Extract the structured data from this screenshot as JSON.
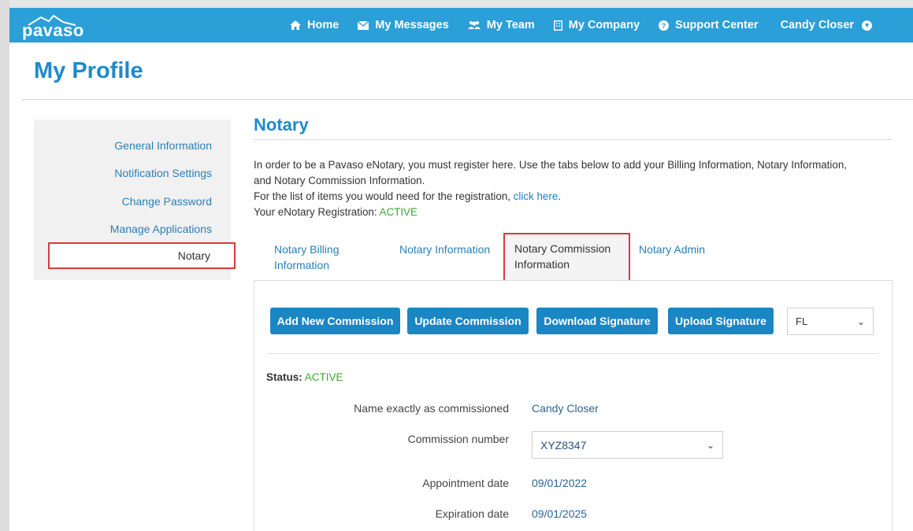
{
  "brand": {
    "logo_text": "pavaso"
  },
  "nav": {
    "items": [
      {
        "label": "Home",
        "icon": "home-icon"
      },
      {
        "label": "My Messages",
        "icon": "envelope-icon"
      },
      {
        "label": "My Team",
        "icon": "team-icon"
      },
      {
        "label": "My Company",
        "icon": "building-icon"
      },
      {
        "label": "Support Center",
        "icon": "question-circle-icon"
      }
    ],
    "user": "Candy Closer"
  },
  "page": {
    "title": "My Profile"
  },
  "sidebar": {
    "items": [
      {
        "label": "General Information"
      },
      {
        "label": "Notification Settings"
      },
      {
        "label": "Change Password"
      },
      {
        "label": "Manage Applications"
      },
      {
        "label": "Notary",
        "active": true
      }
    ]
  },
  "notary": {
    "title": "Notary",
    "intro_line1": "In order to be a Pavaso eNotary, you must register here. Use the tabs below to add your Billing Information, Notary Information, and Notary Commission Information.",
    "intro_line2_prefix": "For the list of items you would need for the registration, ",
    "intro_link": "click here",
    "intro_line2_suffix": ".",
    "registration_label": "Your eNotary Registration: ",
    "registration_status": "ACTIVE"
  },
  "tabs": {
    "billing": "Notary Billing Information",
    "information": "Notary Information",
    "commission": "Notary Commission Information",
    "admin": "Notary Admin"
  },
  "actions": {
    "add": "Add New Commission",
    "update": "Update Commission",
    "download": "Download Signature",
    "upload": "Upload Signature",
    "state": "FL"
  },
  "commission": {
    "status_label": "Status:",
    "status_value": "ACTIVE",
    "fields": {
      "name_label": "Name exactly as commissioned",
      "name_value": "Candy Closer",
      "number_label": "Commission number",
      "number_value": "XYZ8347",
      "appointment_label": "Appointment date",
      "appointment_value": "09/01/2022",
      "expiration_label": "Expiration date",
      "expiration_value": "09/01/2025"
    }
  },
  "colors": {
    "brand_blue": "#2a9fd8",
    "title_blue": "#1f8ac9",
    "button_blue": "#1b86c4",
    "active_green": "#3aaa35",
    "highlight_red": "#d9383c"
  }
}
